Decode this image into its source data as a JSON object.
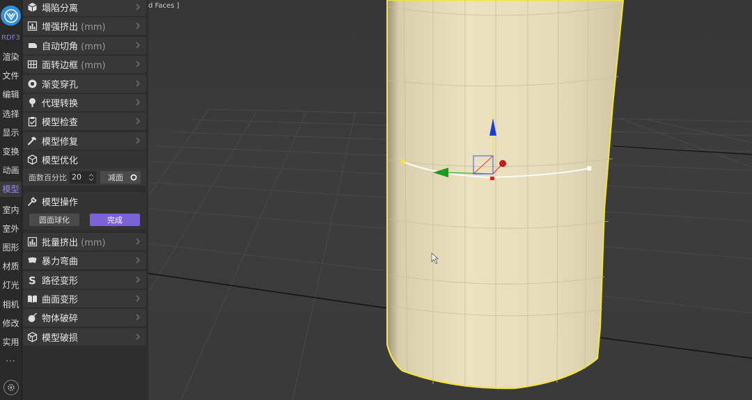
{
  "rail": {
    "brand": "RDF3",
    "items": [
      "渲染",
      "文件",
      "编辑",
      "选择",
      "显示",
      "变换",
      "动画",
      "模型",
      "室内",
      "室外",
      "图形",
      "材质",
      "灯光",
      "相机",
      "修改",
      "实用"
    ],
    "active_index": 7,
    "more": "···"
  },
  "panel": {
    "tools": [
      {
        "label": "塌陷分离",
        "unit": "",
        "icon": "cube-icon"
      },
      {
        "label": "增强挤出",
        "unit": " (mm)",
        "icon": "bar-chart-icon"
      },
      {
        "label": "自动切角",
        "unit": " (mm)",
        "icon": "bevel-icon"
      },
      {
        "label": "面转边框",
        "unit": " (mm)",
        "icon": "grid-icon"
      },
      {
        "label": "渐变穿孔",
        "unit": "",
        "icon": "hole-icon"
      },
      {
        "label": "代理转换",
        "unit": "",
        "icon": "tree-icon"
      },
      {
        "label": "模型检查",
        "unit": "",
        "icon": "clipboard-check-icon"
      },
      {
        "label": "模型修复",
        "unit": "",
        "icon": "hammer-icon"
      }
    ],
    "optimize": {
      "title": "模型优化",
      "face_percent_label": "面数百分比",
      "face_percent_value": "20",
      "reduce_label": "减面"
    },
    "operate": {
      "title": "模型操作",
      "round_label": "圆面球化",
      "done_label": "完成"
    },
    "tools2": [
      {
        "label": "批量挤出",
        "unit": " (mm)",
        "icon": "bar-chart-icon"
      },
      {
        "label": "暴力弯曲",
        "unit": "",
        "icon": "bend-icon"
      },
      {
        "label": "路径变形",
        "unit": "",
        "icon": "s-path-icon"
      },
      {
        "label": "曲面变形",
        "unit": "",
        "icon": "book-icon"
      },
      {
        "label": "物体破碎",
        "unit": "",
        "icon": "bomb-icon"
      },
      {
        "label": "模型破损",
        "unit": "",
        "icon": "broken-cube-icon"
      }
    ]
  },
  "viewport": {
    "label": "d Faces ]",
    "gizmo": {
      "axis_z": "z"
    },
    "colors": {
      "cylinder": "#e8dcb8",
      "selection": "#f2e43a",
      "grid": "#4a4a4a",
      "floor": "#3c3c3c"
    }
  }
}
